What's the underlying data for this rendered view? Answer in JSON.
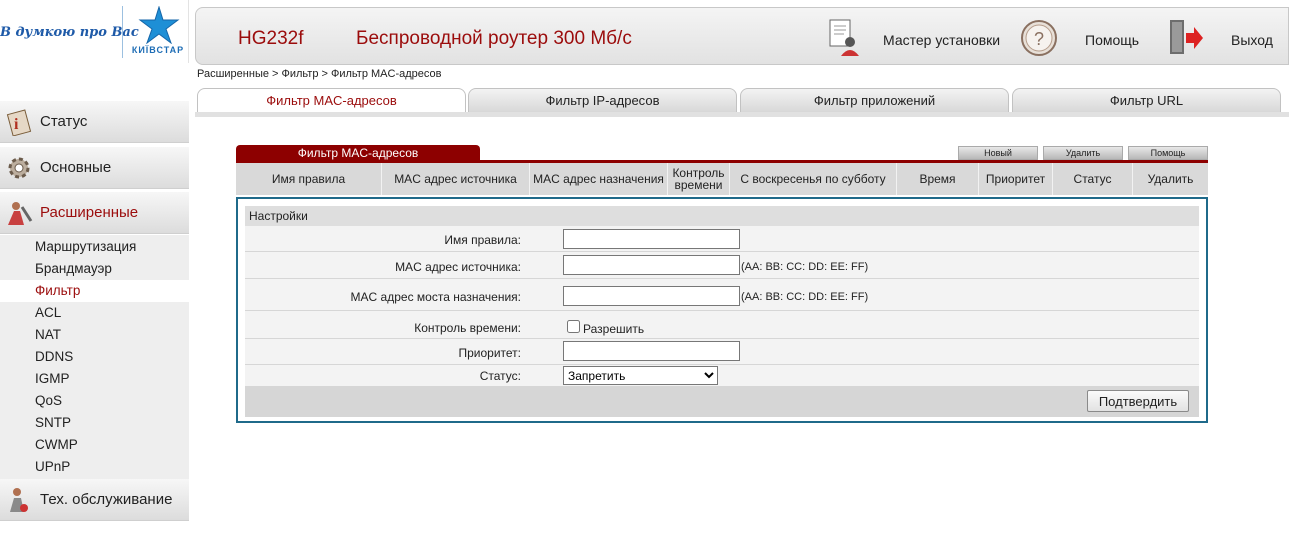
{
  "brand": {
    "slogan": "В думкою про Вас",
    "name": "КИЇВСТАР",
    "colors": {
      "accent": "#9b0c0c",
      "section": "#8d0000",
      "panel_border": "#1f6a8a",
      "logo_blue": "#1e6db5"
    }
  },
  "header": {
    "model": "HG232f",
    "product": "Беспроводной роутер 300 Мб/с",
    "wizard_label": "Мастер установки",
    "help_label": "Помощь",
    "exit_label": "Выход",
    "icons": [
      "wizard-icon",
      "help-icon",
      "exit-icon"
    ]
  },
  "sidebar": {
    "main": [
      {
        "label": "Статус",
        "icon": "status-icon"
      },
      {
        "label": "Основные",
        "icon": "gear-icon"
      },
      {
        "label": "Расширенные",
        "icon": "advanced-icon",
        "active": true
      },
      {
        "label": "Тех. обслуживание",
        "icon": "maintenance-icon"
      }
    ],
    "sub": [
      "Маршрутизация",
      "Брандмауэр",
      "Фильтр",
      "ACL",
      "NAT",
      "DDNS",
      "IGMP",
      "QoS",
      "SNTP",
      "CWMP",
      "UPnP"
    ],
    "active_sub": "Фильтр"
  },
  "breadcrumb": "Расширенные > Фильтр > Фильтр MAC-адресов",
  "tabs": [
    "Фильтр MAC-адресов",
    "Фильтр IP-адресов",
    "Фильтр приложений",
    "Фильтр URL"
  ],
  "active_tab": "Фильтр MAC-адресов",
  "section": {
    "title": "Фильтр MAC-адресов",
    "buttons": {
      "new": "Новый",
      "delete": "Удалить",
      "help": "Помощь"
    },
    "columns": [
      "Имя правила",
      "MAC адрес источника",
      "MAC адрес назначения",
      "Контроль времени",
      "С воскресенья по субботу",
      "Время",
      "Приоритет",
      "Статус",
      "Удалить"
    ]
  },
  "form": {
    "title": "Настройки",
    "rule_name_label": "Имя правила:",
    "rule_name_value": "",
    "src_mac_label": "MAC адрес источника:",
    "src_mac_value": "",
    "src_mac_hint": "(AA: BB: CC: DD: EE: FF)",
    "dst_mac_label": "MAC адрес моста назначения:",
    "dst_mac_value": "",
    "dst_mac_hint": "(AA: BB: CC: DD: EE: FF)",
    "time_control_label": "Контроль времени:",
    "time_control_checkbox_label": "Разрешить",
    "time_control_checked": false,
    "priority_label": "Приоритет:",
    "priority_value": "",
    "status_label": "Статус:",
    "status_value": "Запретить",
    "confirm_label": "Подтвердить"
  }
}
